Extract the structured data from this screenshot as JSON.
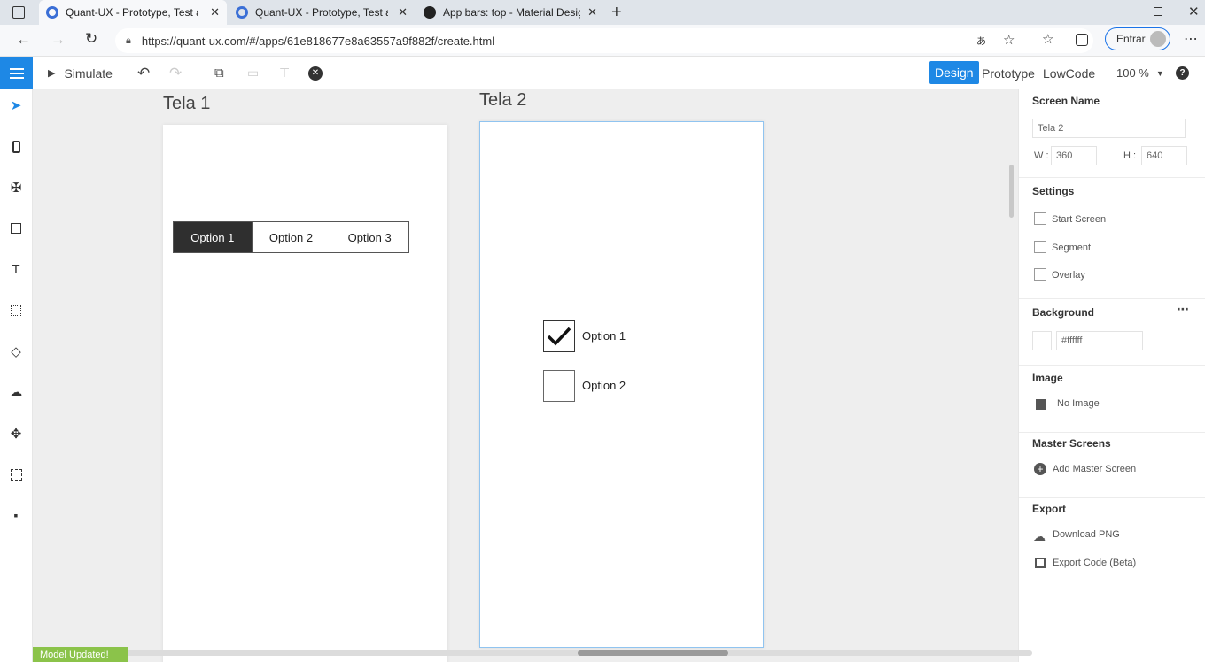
{
  "browser": {
    "tabs": [
      {
        "title": "Quant-UX - Prototype, Test and L",
        "active": true
      },
      {
        "title": "Quant-UX - Prototype, Test and L",
        "active": false
      },
      {
        "title": "App bars: top - Material Design",
        "active": false
      }
    ],
    "url": "https://quant-ux.com/#/apps/61e818677e8a63557a9f882f/create.html",
    "profile_button": "Entrar"
  },
  "toolbar": {
    "simulate_label": "Simulate",
    "modes": {
      "design": "Design",
      "prototype": "Prototype",
      "lowcode": "LowCode"
    },
    "zoom": "100 %",
    "accent": "#1e88e5"
  },
  "screens": [
    {
      "title": "Tela 1",
      "segments": [
        "Option 1",
        "Option 2",
        "Option 3"
      ],
      "selected_segment": "Option 1"
    },
    {
      "title": "Tela 2",
      "checkboxes": [
        {
          "label": "Option 1",
          "checked": true
        },
        {
          "label": "Option 2",
          "checked": false
        }
      ]
    }
  ],
  "panel": {
    "screen_name_heading": "Screen Name",
    "screen_name_value": "Tela 2",
    "w_label": "W :",
    "w_value": "360",
    "h_label": "H :",
    "h_value": "640",
    "settings_heading": "Settings",
    "settings": [
      "Start Screen",
      "Segment",
      "Overlay"
    ],
    "background_heading": "Background",
    "background_value": "#ffffff",
    "image_heading": "Image",
    "image_value": "No Image",
    "master_heading": "Master Screens",
    "master_action": "Add Master Screen",
    "export_heading": "Export",
    "export_png": "Download PNG",
    "export_code": "Export Code (Beta)"
  },
  "status": {
    "toast": "Model Updated!"
  }
}
